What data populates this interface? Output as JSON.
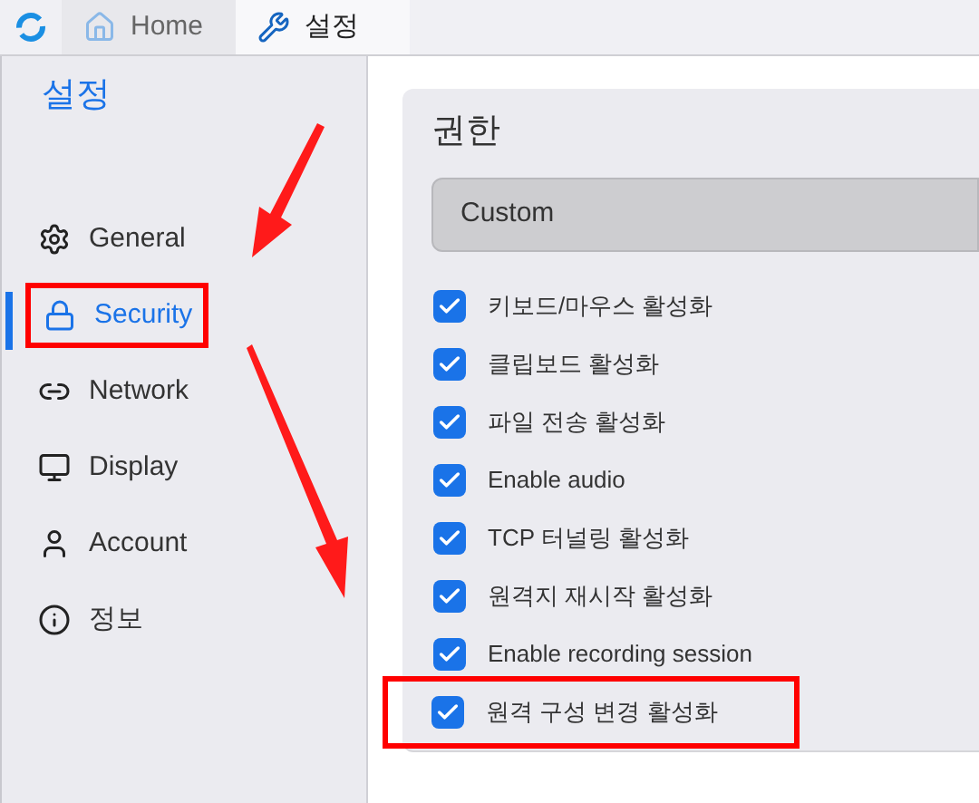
{
  "tabs": [
    {
      "label": "Home",
      "selected": false
    },
    {
      "label": "설정",
      "selected": true
    }
  ],
  "sidebar": {
    "title": "설정",
    "items": [
      {
        "label": "General",
        "selected": false,
        "highlighted": false
      },
      {
        "label": "Security",
        "selected": true,
        "highlighted": true
      },
      {
        "label": "Network",
        "selected": false,
        "highlighted": false
      },
      {
        "label": "Display",
        "selected": false,
        "highlighted": false
      },
      {
        "label": "Account",
        "selected": false,
        "highlighted": false
      },
      {
        "label": "정보",
        "selected": false,
        "highlighted": false
      }
    ]
  },
  "permissions": {
    "title": "권한",
    "preset": "Custom",
    "options": [
      {
        "label": "키보드/마우스 활성화",
        "checked": true,
        "highlighted": false
      },
      {
        "label": "클립보드 활성화",
        "checked": true,
        "highlighted": false
      },
      {
        "label": "파일 전송 활성화",
        "checked": true,
        "highlighted": false
      },
      {
        "label": "Enable audio",
        "checked": true,
        "highlighted": false
      },
      {
        "label": "TCP 터널링 활성화",
        "checked": true,
        "highlighted": false
      },
      {
        "label": "원격지 재시작 활성화",
        "checked": true,
        "highlighted": false
      },
      {
        "label": "Enable recording session",
        "checked": true,
        "highlighted": false
      },
      {
        "label": "원격 구성 변경 활성화",
        "checked": true,
        "highlighted": true
      }
    ]
  }
}
